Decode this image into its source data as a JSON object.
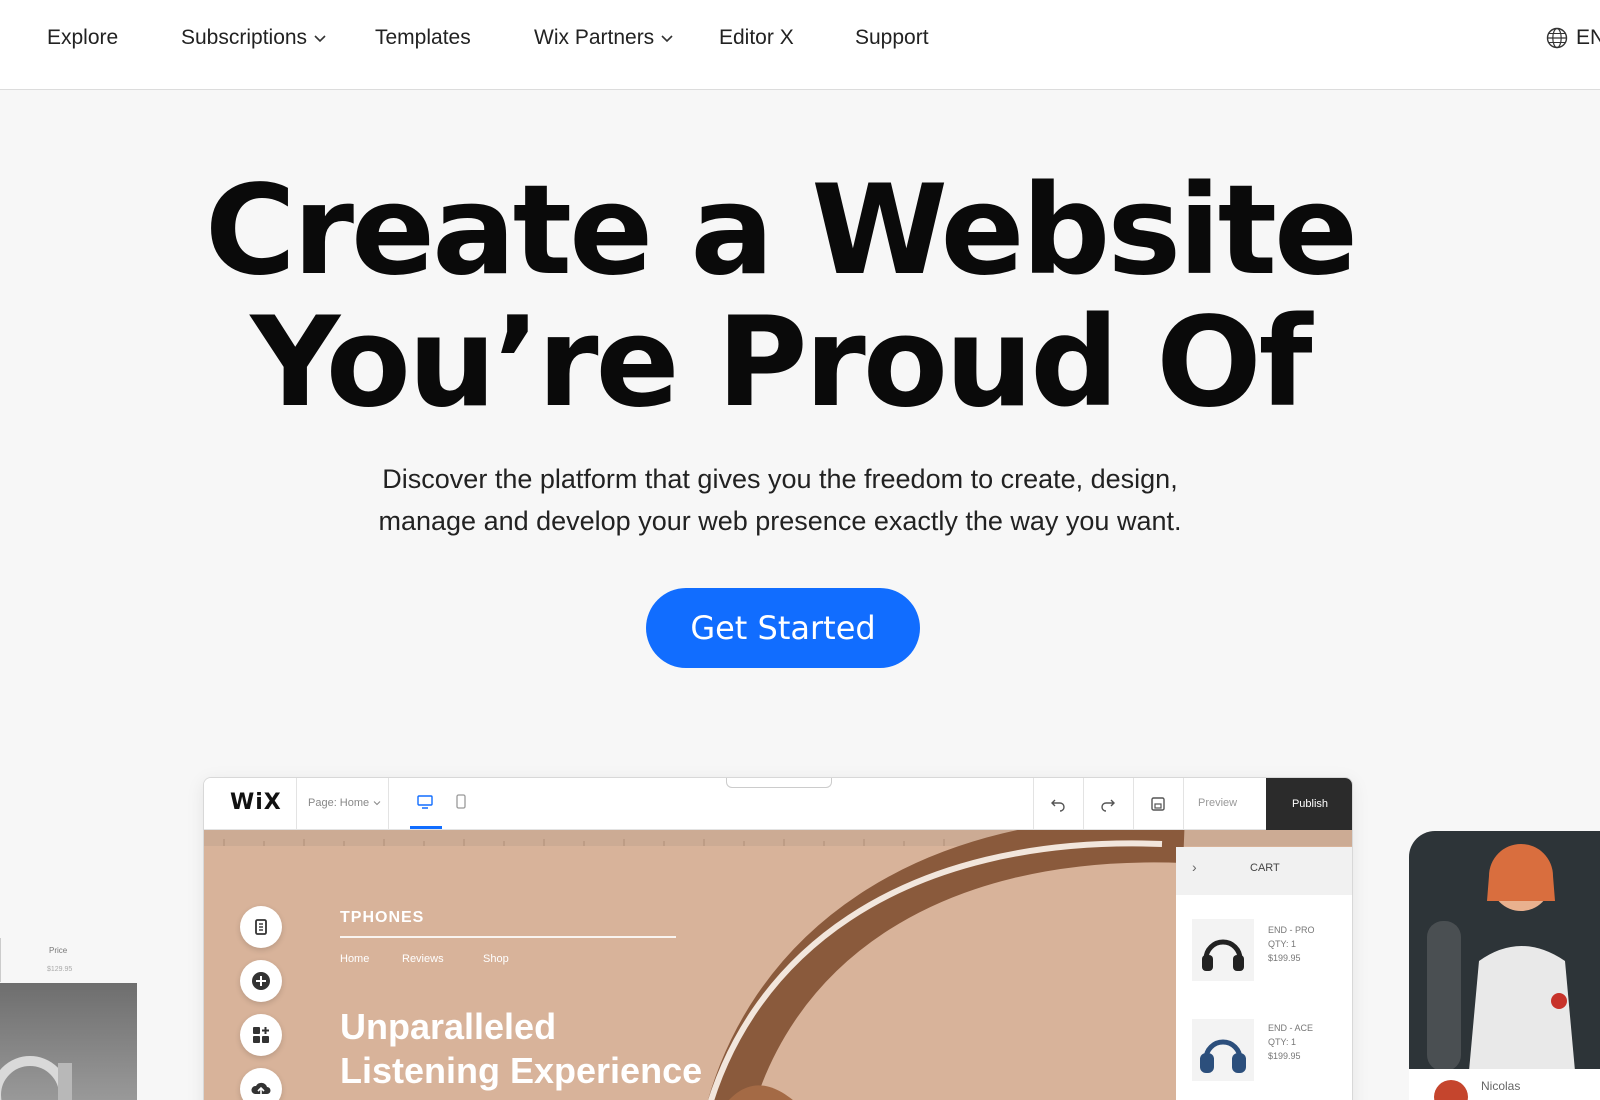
{
  "nav": {
    "items": [
      {
        "label": "Explore",
        "has_dropdown": false
      },
      {
        "label": "Subscriptions",
        "has_dropdown": true
      },
      {
        "label": "Templates",
        "has_dropdown": false
      },
      {
        "label": "Wix Partners",
        "has_dropdown": true
      },
      {
        "label": "Editor X",
        "has_dropdown": false
      },
      {
        "label": "Support",
        "has_dropdown": false
      }
    ],
    "language": "EN",
    "language_icon": "globe-icon"
  },
  "hero": {
    "title_line1": "Create a Website",
    "title_line2": "You’re Proud Of",
    "subtitle_line1": "Discover the platform that gives you the freedom to create, design,",
    "subtitle_line2": "manage and develop your web presence exactly the way you want.",
    "cta_label": "Get Started"
  },
  "editor": {
    "logo": "WiX",
    "page_selector": "Page: Home",
    "preview_label": "Preview",
    "publish_label": "Publish",
    "site": {
      "brand": "TPHONES",
      "links": [
        "Home",
        "Reviews",
        "Shop"
      ],
      "headline_line1": "Unparalleled",
      "headline_line2": "Listening Experience"
    },
    "cart": {
      "title": "CART",
      "items": [
        {
          "name": "END - PRO",
          "qty": "QTY: 1",
          "price": "$199.95"
        },
        {
          "name": "END - ACE",
          "qty": "QTY: 1",
          "price": "$199.95"
        }
      ]
    }
  },
  "side": {
    "price_label": "Price",
    "price_value": "$129.95",
    "profile_name": "Nicolas"
  },
  "colors": {
    "accent": "#116dff",
    "canvas": "#d8b39a",
    "publish_bg": "#2b2b2b"
  }
}
